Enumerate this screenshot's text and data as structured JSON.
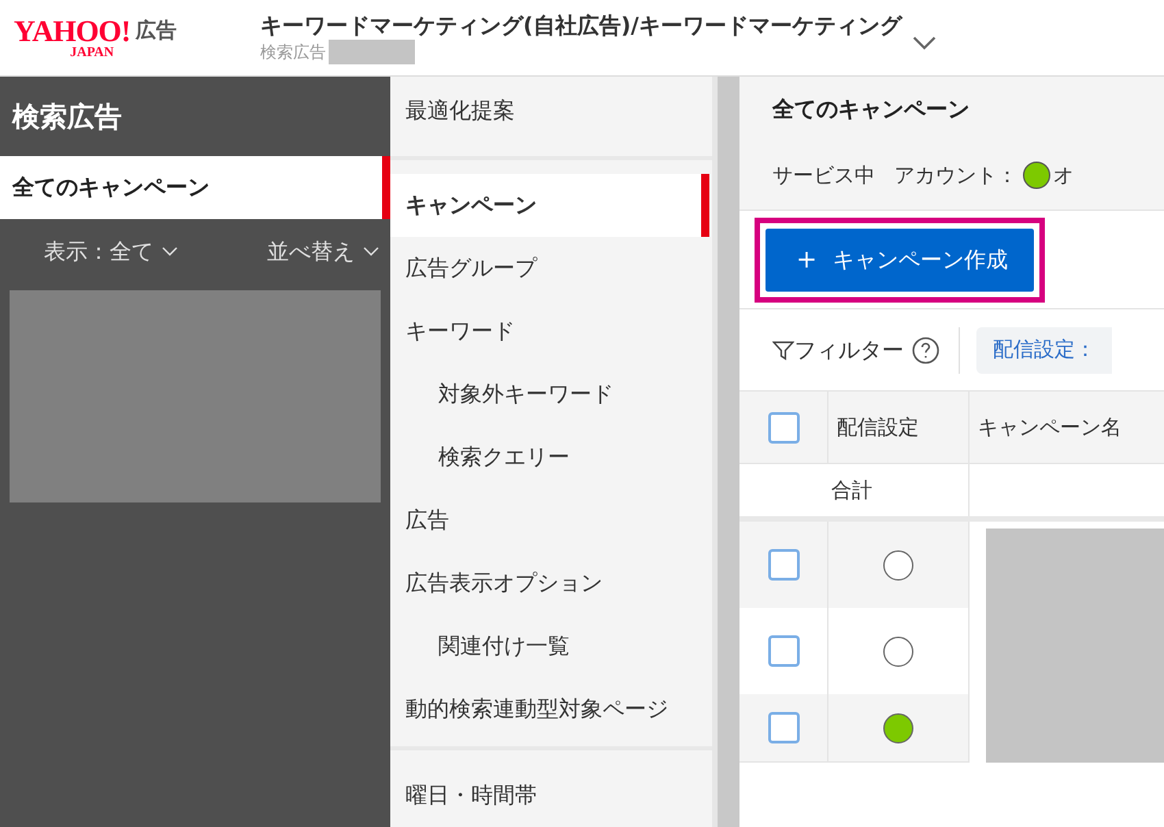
{
  "header": {
    "logo": {
      "brand": "YAHOO!",
      "sub": "JAPAN",
      "product": "広告"
    },
    "title": "キーワードマーケティング(自社広告)/キーワードマーケティング",
    "subtitle": "検索広告"
  },
  "sidebar": {
    "title": "検索広告",
    "items": [
      {
        "label": "全てのキャンペーン",
        "selected": true
      }
    ],
    "filters": [
      "表示：全て",
      "並べ替え"
    ]
  },
  "nav": {
    "groups": [
      [
        {
          "label": "最適化提案",
          "selected": false
        }
      ],
      [
        {
          "label": "キャンペーン",
          "selected": true
        },
        {
          "label": "広告グループ",
          "selected": false
        },
        {
          "label": "キーワード",
          "selected": false,
          "children": [
            {
              "label": "対象外キーワード",
              "selected": false
            },
            {
              "label": "検索クエリー",
              "selected": false
            }
          ]
        },
        {
          "label": "広告",
          "selected": false
        },
        {
          "label": "広告表示オプション",
          "selected": false,
          "children": [
            {
              "label": "関連付け一覧",
              "selected": false
            }
          ]
        },
        {
          "label": "動的検索連動型対象ページ",
          "selected": false
        }
      ],
      [
        {
          "label": "曜日・時間帯",
          "selected": false
        }
      ]
    ]
  },
  "main": {
    "title": "全てのキャンペーン",
    "status": "サービス中",
    "account_label": "アカウント：",
    "account_status": {
      "color": "#7dc900",
      "label": "オ"
    },
    "create_button": {
      "icon": "＋",
      "label": "キャンペーン作成",
      "highlighted": true
    },
    "filter": {
      "label": "フィルター",
      "chip": "配信設定："
    },
    "table": {
      "select_all_checked": false,
      "columns": [
        "配信設定",
        "キャンペーン名"
      ],
      "total_label": "合計",
      "rows": [
        {
          "checked": false,
          "on": false
        },
        {
          "checked": false,
          "on": false
        },
        {
          "checked": false,
          "on": true
        }
      ]
    }
  }
}
